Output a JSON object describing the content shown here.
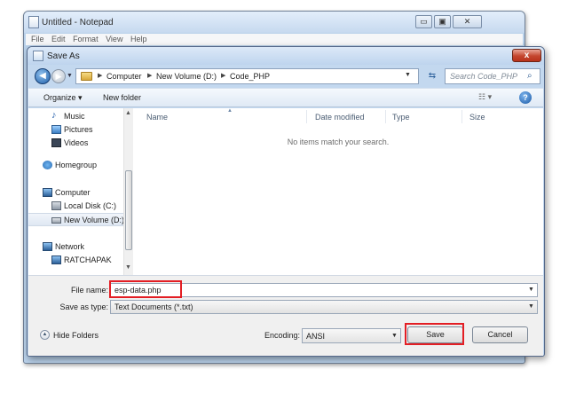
{
  "notepad": {
    "title": "Untitled - Notepad",
    "menu": [
      "File",
      "Edit",
      "Format",
      "View",
      "Help"
    ],
    "controls": {
      "minimize": "▭",
      "maximize": "▣",
      "close": "✕"
    }
  },
  "dialog": {
    "title": "Save As",
    "close": "x",
    "breadcrumb": [
      "Computer",
      "New Volume (D:)",
      "Code_PHP"
    ],
    "search_placeholder": "Search Code_PHP",
    "toolbar": {
      "organize": "Organize ▾",
      "new_folder": "New folder",
      "views": "☷ ▾",
      "help": "?"
    },
    "nav": {
      "items": [
        {
          "label": "Music",
          "icon": "music-icon"
        },
        {
          "label": "Pictures",
          "icon": "pictures-icon"
        },
        {
          "label": "Videos",
          "icon": "videos-icon"
        },
        {
          "label": "Homegroup",
          "icon": "homegroup-icon"
        },
        {
          "label": "Computer",
          "icon": "computer-icon"
        },
        {
          "label": "Local Disk (C:)",
          "icon": "drive-icon"
        },
        {
          "label": "New Volume (D:)",
          "icon": "drive-icon",
          "selected": true
        },
        {
          "label": "Network",
          "icon": "network-icon"
        },
        {
          "label": "RATCHAPAK",
          "icon": "pc-icon"
        }
      ]
    },
    "columns": [
      "Name",
      "Date modified",
      "Type",
      "Size"
    ],
    "empty_message": "No items match your search.",
    "file_name_label": "File name:",
    "file_name_value": "esp-data.php",
    "save_type_label": "Save as type:",
    "save_type_value": "Text Documents (*.txt)",
    "hide_folders": "Hide Folders",
    "encoding_label": "Encoding:",
    "encoding_value": "ANSI",
    "save": "Save",
    "cancel": "Cancel"
  },
  "colors": {
    "highlight": "#e31e24",
    "accent": "#1f5fa8"
  }
}
